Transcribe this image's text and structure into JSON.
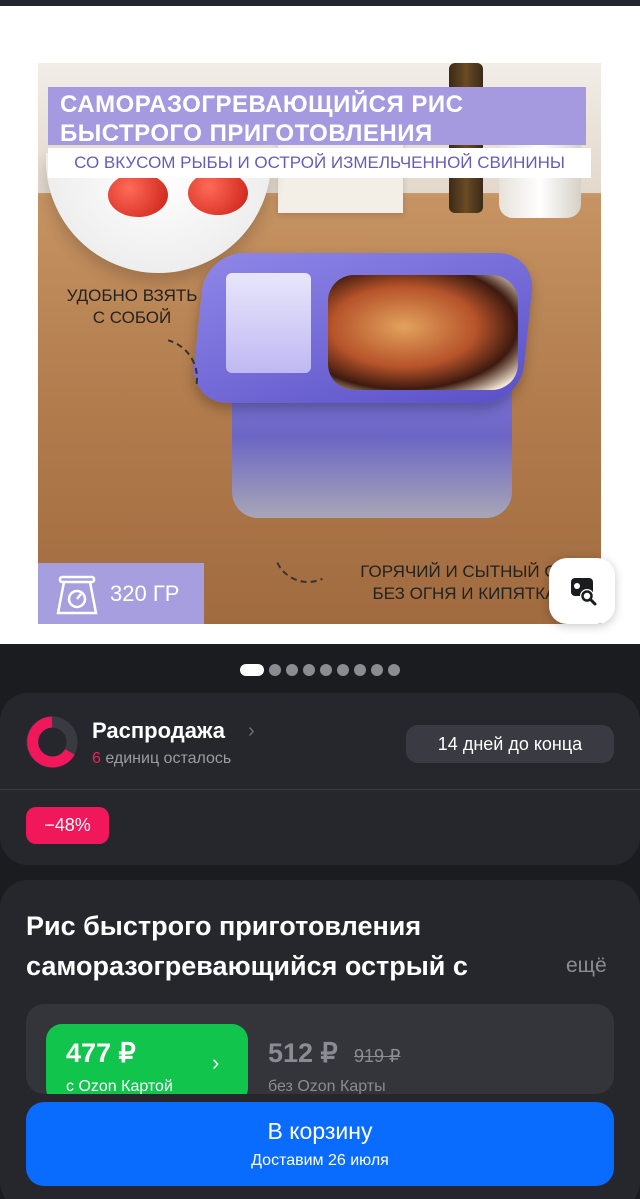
{
  "product_image": {
    "banner_title_line1": "САМОРАЗОГРЕВАЮЩИЙСЯ РИС",
    "banner_title_line2": "БЫСТРОГО ПРИГОТОВЛЕНИЯ",
    "banner_subtitle": "СО ВКУСОМ РЫБЫ И ОСТРОЙ ИЗМЕЛЬЧЕННОЙ СВИНИНЫ",
    "note_left_line1": "УДОБНО ВЗЯТЬ",
    "note_left_line2": "С СОБОЙ",
    "note_right_line1": "ГОРЯЧИЙ И СЫТНЫЙ ОБ",
    "note_right_line2": "БЕЗ ОГНЯ И КИПЯТКА",
    "weight": "320 ГР"
  },
  "gallery": {
    "total_slides": 9,
    "active_slide": 1
  },
  "sale": {
    "title": "Распродажа",
    "units_left_count": "6",
    "units_left_text": " единиц осталось",
    "deadline": "14 дней до конца",
    "discount": "−48%"
  },
  "product": {
    "title": "Рис быстрого приготовления саморазогревающийся острый с",
    "more_label": "ещё"
  },
  "prices": {
    "ozon_price": "477 ₽",
    "ozon_caption": "с Ozon Картой",
    "regular_price": "512 ₽",
    "old_price": "919 ₽",
    "regular_caption": "без Ozon Карты"
  },
  "cart": {
    "label": "В корзину",
    "delivery": "Доставим 26 июля"
  },
  "colors": {
    "accent_blue": "#0a6cff",
    "ozon_green": "#10c44c",
    "sale_pink": "#f1175b",
    "dark_bg": "#1b1c20"
  }
}
